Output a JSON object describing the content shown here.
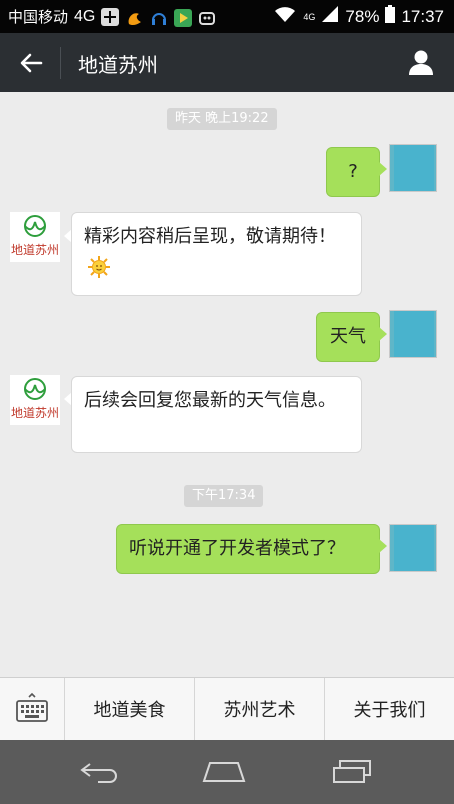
{
  "status_bar": {
    "carrier": "中国移动",
    "network": "4G",
    "mobile_data": "4G",
    "battery": "78%",
    "time": "17:37"
  },
  "header": {
    "title": "地道苏州",
    "back_icon": "arrow-left-icon",
    "profile_icon": "person-icon"
  },
  "chat": {
    "timestamps": [
      "昨天 晚上19:22",
      "下午17:34"
    ],
    "bot_logo_text": "地道苏州",
    "messages": [
      {
        "from": "user",
        "text": "?"
      },
      {
        "from": "bot",
        "text": "精彩内容稍后呈现，敬请期待！"
      },
      {
        "from": "user",
        "text": "天气"
      },
      {
        "from": "bot",
        "text": "后续会回复您最新的天气信息。"
      },
      {
        "from": "user",
        "text": "听说开通了开发者模式了？"
      }
    ]
  },
  "menu": {
    "keyboard_icon": "keyboard-icon",
    "items": [
      "地道美食",
      "苏州艺术",
      "关于我们"
    ]
  },
  "colors": {
    "header_bg": "#2b2f33",
    "chat_bg": "#ececec",
    "user_bubble": "#a5e05a",
    "bot_bubble": "#ffffff",
    "logo_green": "#2e9e3c",
    "logo_red": "#c0392b"
  }
}
